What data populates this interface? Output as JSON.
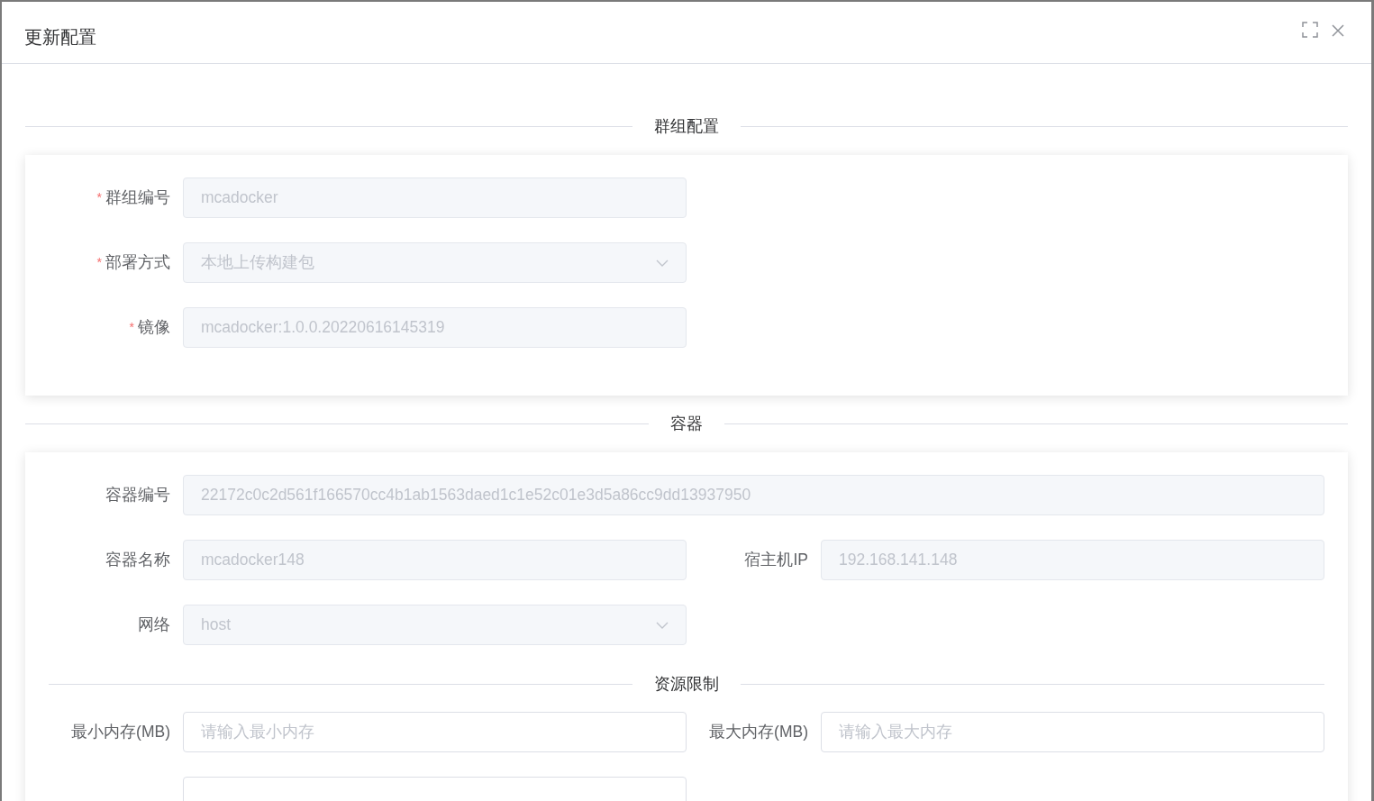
{
  "dialog": {
    "title": "更新配置"
  },
  "sections": [
    {
      "title": "群组配置",
      "rows": [
        [
          {
            "label": "群组编号",
            "required_mark": "*",
            "kind": "input",
            "disabled": true,
            "value": "mcadocker"
          }
        ],
        [
          {
            "label": "部署方式",
            "required_mark": "*",
            "kind": "select",
            "disabled": true,
            "value": "本地上传构建包"
          }
        ],
        [
          {
            "label": "镜像",
            "required_mark": "*",
            "kind": "input",
            "disabled": true,
            "value": "mcadocker:1.0.0.20220616145319"
          }
        ]
      ]
    },
    {
      "title": "容器",
      "rows": [
        [
          {
            "label": "容器编号",
            "kind": "input",
            "disabled": true,
            "wide": true,
            "value": "22172c0c2d561f166570cc4b1ab1563daed1c1e52c01e3d5a86cc9dd13937950"
          }
        ],
        [
          {
            "label": "容器名称",
            "kind": "input",
            "disabled": true,
            "value": "mcadocker148"
          },
          {
            "label": "宿主机IP",
            "kind": "input",
            "disabled": true,
            "value": "192.168.141.148"
          }
        ],
        [
          {
            "label": "网络",
            "kind": "select",
            "disabled": true,
            "value": "host"
          }
        ]
      ],
      "subsection": {
        "title": "资源限制",
        "rows": [
          [
            {
              "label": "最小内存(MB)",
              "kind": "input",
              "placeholder": "请输入最小内存"
            },
            {
              "label": "最大内存(MB)",
              "kind": "input",
              "placeholder": "请输入最大内存"
            }
          ],
          [
            {
              "kind": "input"
            }
          ]
        ]
      }
    }
  ]
}
